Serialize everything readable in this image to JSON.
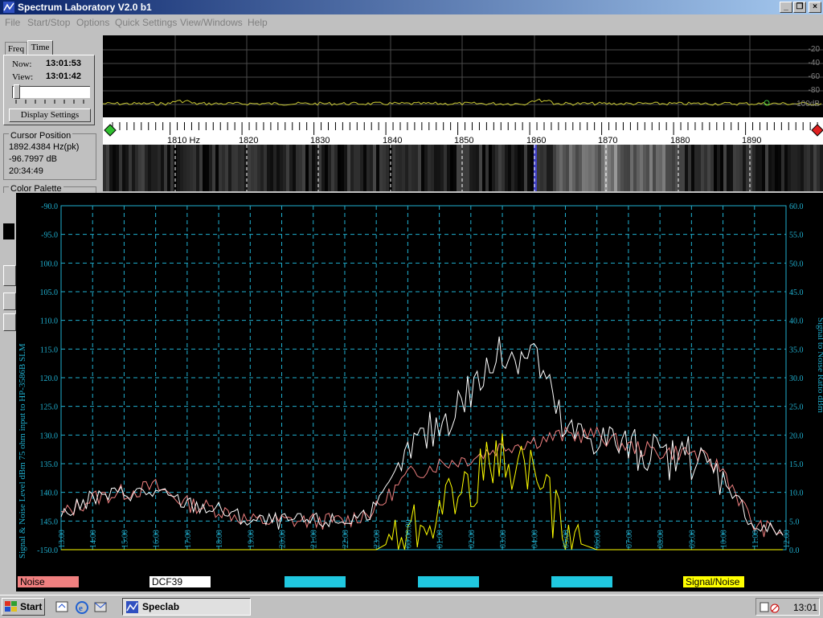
{
  "window": {
    "title": "Spectrum Laboratory V2.0 b1",
    "controls": [
      "_",
      "❐",
      "×"
    ]
  },
  "menu": [
    "File",
    "Start/Stop",
    "Options",
    "Quick Settings",
    "View/Windows",
    "Help"
  ],
  "left_panel": {
    "tabs": [
      "Freq",
      "Time"
    ],
    "now_label": "Now:",
    "now_value": "13:01:53",
    "view_label": "View:",
    "view_value": "13:01:42",
    "display_settings": "Display Settings",
    "cursor_group_title": "Cursor Position",
    "cursor_freq": "1892.4384 Hz(pk)",
    "cursor_level": "-96.7997 dB",
    "cursor_time": "20:34:49",
    "palette_group_title": "Color Palette"
  },
  "spectrum": {
    "db_ticks": [
      "-20",
      "-40",
      "-60",
      "-80",
      "-100dB"
    ],
    "freq_labels": [
      "1810 Hz",
      "1820",
      "1830",
      "1840",
      "1850",
      "1860",
      "1870",
      "1880",
      "1890"
    ],
    "trace_color": "#c8c832"
  },
  "chart_data": {
    "type": "line",
    "ylabel": "Signal & Noise Level  dBm 75 ohm input to HP-3586B SLM",
    "y2label": "Signal to Noise Ratio  dBm",
    "ylim": [
      -150,
      -90
    ],
    "y2lim": [
      0,
      60
    ],
    "y_ticks": [
      "-90.0",
      "-95.0",
      "100.0",
      "105.0",
      "110.0",
      "115.0",
      "120.0",
      "125.0",
      "130.0",
      "135.0",
      "140.0",
      "145.0",
      "-150.0"
    ],
    "y2_ticks": [
      "60.0",
      "55.0",
      "50.0",
      "45.0",
      "40.0",
      "35.0",
      "30.0",
      "25.0",
      "20.0",
      "15.0",
      "10.0",
      "5.0",
      "0.0"
    ],
    "x_ticks": [
      "13:00",
      "14:00",
      "15:00",
      "16:00",
      "17:00",
      "18:00",
      "19:00",
      "20:00",
      "21:00",
      "22:00",
      "23:00",
      "00:00:00",
      "01:00",
      "02:00",
      "03:00",
      "04:00",
      "05:00",
      "06:00",
      "07:00",
      "08:00",
      "09:00",
      "10:00",
      "11:00",
      "12:00"
    ],
    "hours": [
      13,
      14,
      15,
      16,
      17,
      18,
      19,
      20,
      21,
      22,
      23,
      0,
      1,
      2,
      3,
      4,
      5,
      6,
      7,
      8,
      9,
      10,
      11,
      12
    ],
    "series": [
      {
        "name": "Noise",
        "color": "#f08080",
        "values": [
          -144,
          -141,
          -140,
          -139,
          -142,
          -143,
          -145,
          -145,
          -145,
          -145,
          -143,
          -137,
          -135,
          -134,
          -132,
          -131,
          -130,
          -130,
          -132,
          -133,
          -133,
          -136,
          -146,
          -147
        ]
      },
      {
        "name": "DCF39",
        "color": "#ffffff",
        "values": [
          -144,
          -141,
          -140,
          -140,
          -142,
          -143,
          -145,
          -145,
          -145,
          -145,
          -143,
          -133,
          -128,
          -122,
          -116,
          -115,
          -130,
          -130,
          -132,
          -134,
          -134,
          -137,
          -146,
          -147
        ]
      },
      {
        "name": "Signal/Noise",
        "color": "#ffff00",
        "values": [
          0,
          0,
          0,
          0,
          0,
          0,
          0,
          0,
          0,
          0,
          0,
          3,
          7,
          12,
          16,
          14,
          2,
          0,
          0,
          0,
          0,
          0,
          0,
          0
        ]
      }
    ],
    "legend": [
      "Noise",
      "DCF39",
      "",
      "",
      "",
      "Signal/Noise"
    ],
    "legend_colors": [
      "#f08080",
      "#ffffff",
      "#20c8e0",
      "#20c8e0",
      "#20c8e0",
      "#ffff00"
    ],
    "grid": true,
    "grid_color": "#20b0d0"
  },
  "taskbar": {
    "start": "Start",
    "task": "Speclab",
    "clock": "13:01"
  }
}
